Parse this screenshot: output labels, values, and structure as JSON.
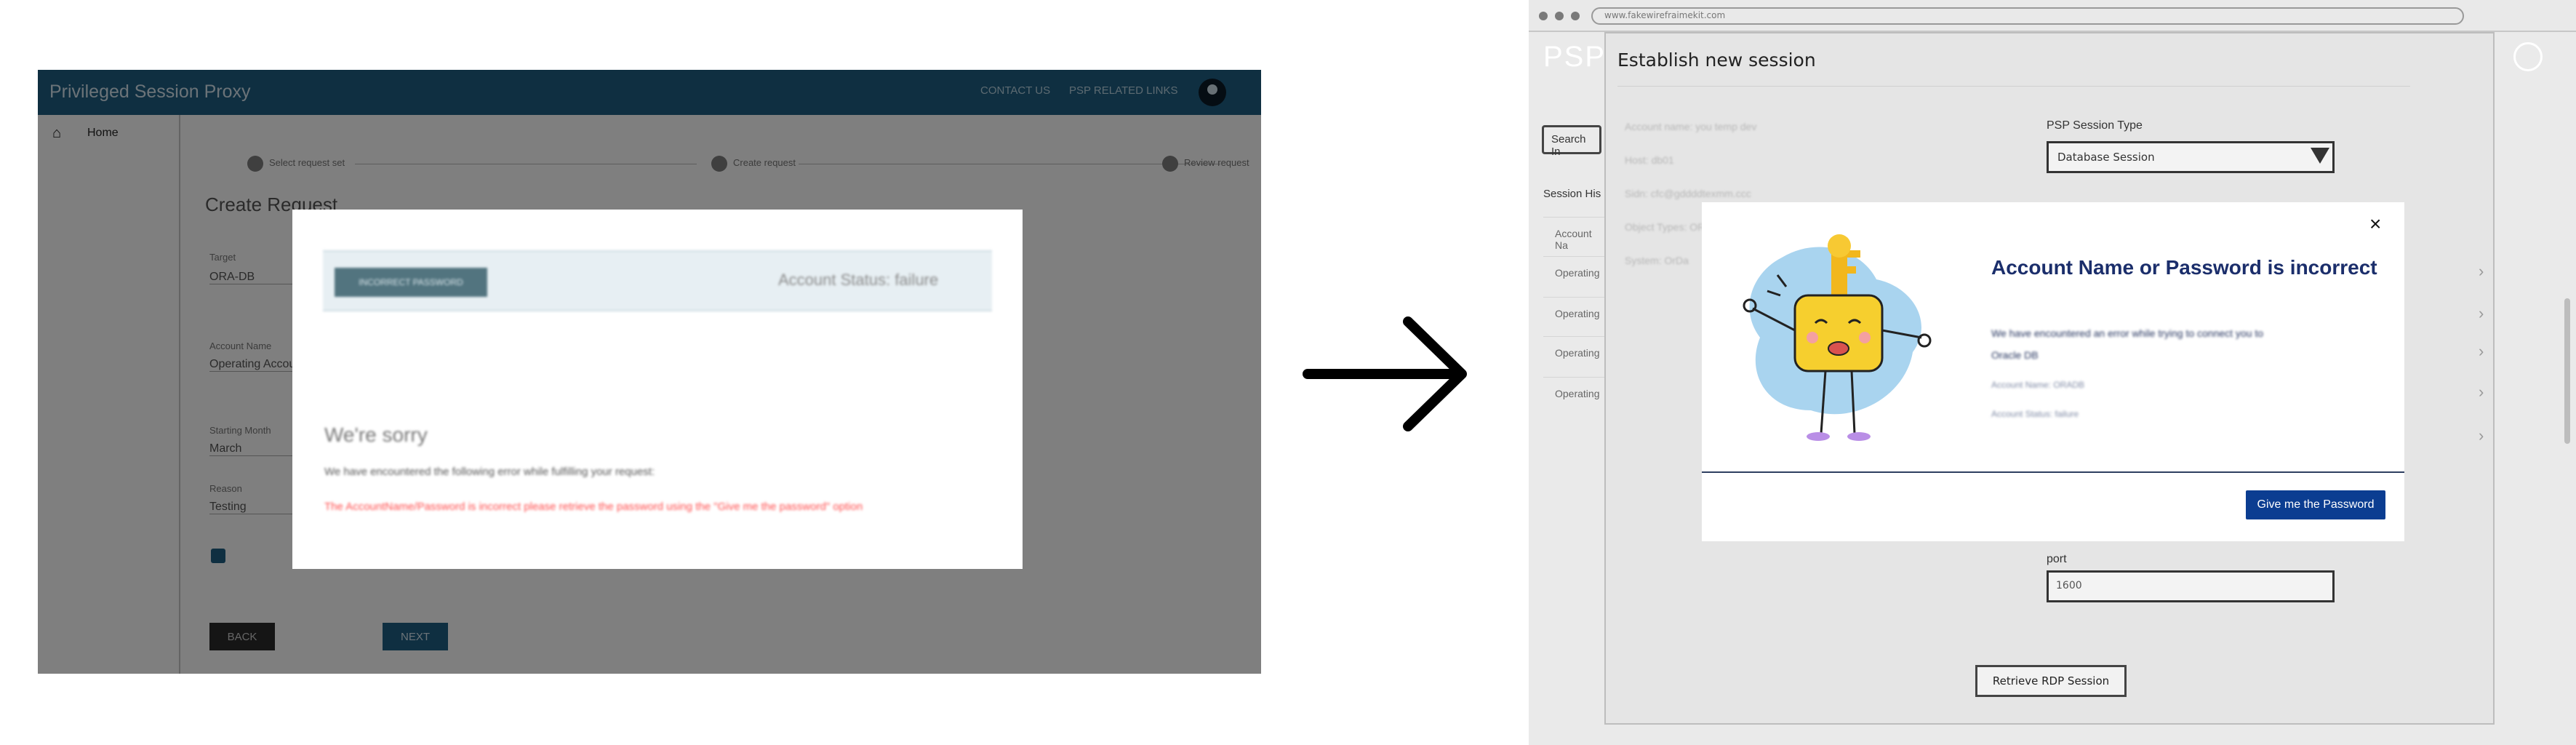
{
  "before": {
    "app_title": "Privileged Session Proxy",
    "nav": {
      "contact": "CONTACT US",
      "psp_links": "PSP RELATED LINKS"
    },
    "sidebar": {
      "home_label": "Home"
    },
    "stepper": {
      "steps": [
        "Select request set",
        "Create request",
        "Review request"
      ]
    },
    "page_title": "Create Request",
    "fields": [
      {
        "label": "Target",
        "value": "ORA-DB"
      },
      {
        "label": "Account Name",
        "value": "Operating Account"
      },
      {
        "label": "Starting Month",
        "value": "March"
      },
      {
        "label": "Reason",
        "value": "Testing"
      }
    ],
    "buttons": {
      "back": "BACK",
      "next": "NEXT"
    },
    "modal": {
      "tag": "INCORRECT PASSWORD",
      "status": "Account Status: failure",
      "title": "We're sorry",
      "text": "We have encountered the following error while fulfilling your request:",
      "error": "The AccountName/Password is incorrect please retrieve the password using the \"Give me the password\" option"
    }
  },
  "after": {
    "url": "www.fakewirefraimekit.com",
    "logo": "PSP",
    "search_button": "Search In",
    "session_history_title": "Session His",
    "session_items": [
      "Account Na",
      "Operating",
      "Operating",
      "Operating",
      "Operating"
    ],
    "panel_title": "Establish new session",
    "blurred_info": [
      "Account name: you temp dev",
      "Host: db01",
      "Sidn: cfc@gddddtexmm.ccc",
      "Object Types: OR",
      "System: OrDa"
    ],
    "psp_type_label": "PSP Session Type",
    "psp_type_value": "Database Session",
    "port_label": "port",
    "port_value": "1600",
    "retrieve_button": "Retrieve RDP Session",
    "popup": {
      "title": "Account Name or Password is incorrect",
      "body_lines": [
        "We have encountered an error while trying to connect you to",
        "Oracle DB",
        "Account Name: ORADB",
        "Account Status: failure"
      ],
      "button": "Give me the Password",
      "close": "×"
    }
  },
  "colors": {
    "brand_blue": "#1f5f83",
    "error_red": "#ff4b4b",
    "popup_title": "#1b2e6b",
    "primary_button": "#0b3d91"
  }
}
